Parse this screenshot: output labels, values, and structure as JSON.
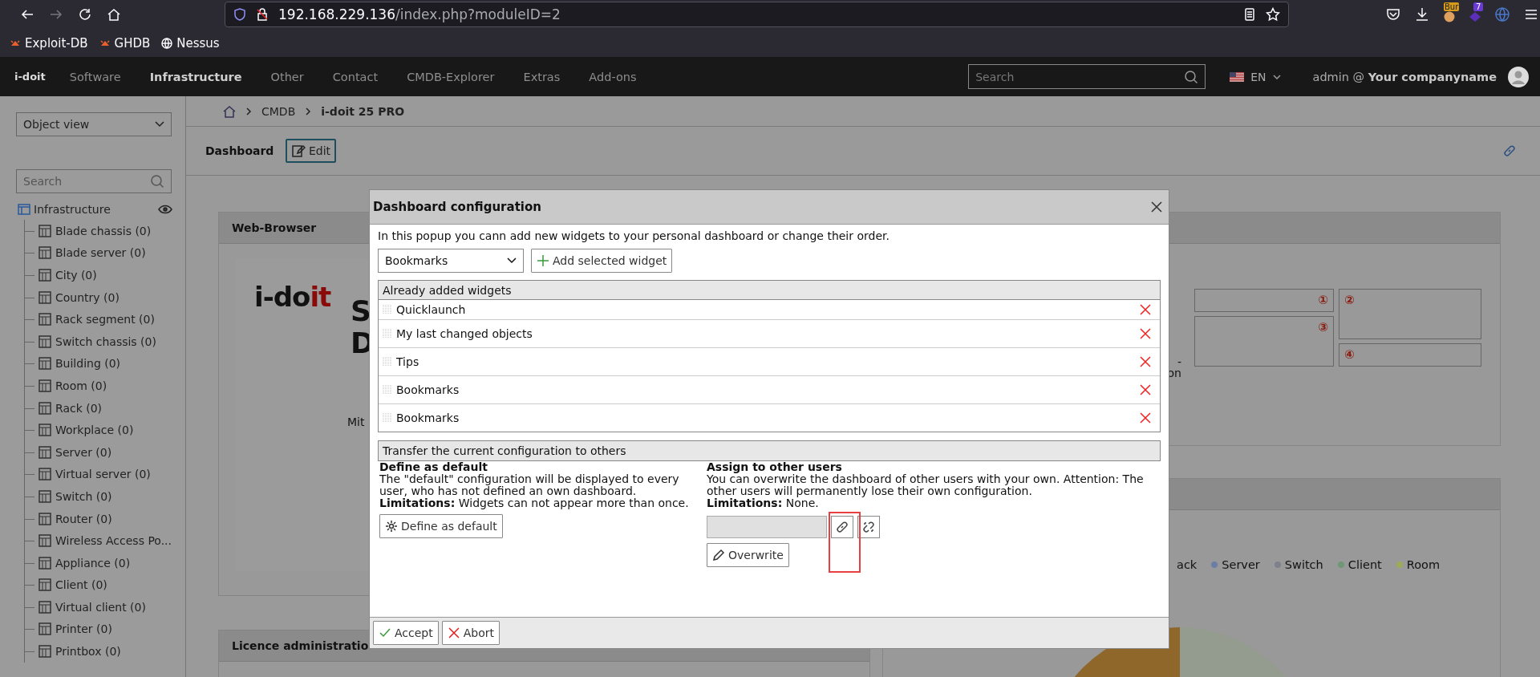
{
  "browser": {
    "url_host": "192.168.229.136",
    "url_path": "/index.php?moduleID=2",
    "forward_disabled": true,
    "extension_label": "Bur",
    "extension_badge": "7",
    "bookmarks": [
      {
        "label": "Exploit-DB",
        "kind": "bug"
      },
      {
        "label": "GHDB",
        "kind": "bug"
      },
      {
        "label": "Nessus",
        "kind": "globe"
      }
    ]
  },
  "navbar": {
    "logo": "i-doit",
    "items": [
      {
        "label": "Software",
        "selected": false
      },
      {
        "label": "Infrastructure",
        "selected": true
      },
      {
        "label": "Other",
        "selected": false
      },
      {
        "label": "Contact",
        "selected": false
      },
      {
        "label": "CMDB-Explorer",
        "selected": false
      },
      {
        "label": "Extras",
        "selected": false
      },
      {
        "label": "Add-ons",
        "selected": false
      }
    ],
    "search": {
      "placeholder": "Search"
    },
    "language": "EN",
    "user": "admin @ **Your companyname**"
  },
  "sidebar": {
    "view_select": "Object view",
    "search": {
      "placeholder": "Search"
    },
    "tree": {
      "label": "Infrastructure",
      "children": [
        {
          "label": "Blade chassis (0)"
        },
        {
          "label": "Blade server (0)"
        },
        {
          "label": "City (0)"
        },
        {
          "label": "Country (0)"
        },
        {
          "label": "Rack segment (0)"
        },
        {
          "label": "Switch chassis (0)"
        },
        {
          "label": "Building (0)"
        },
        {
          "label": "Room (0)"
        },
        {
          "label": "Rack (0)"
        },
        {
          "label": "Workplace (0)"
        },
        {
          "label": "Server (0)"
        },
        {
          "label": "Virtual server (0)"
        },
        {
          "label": "Switch (0)"
        },
        {
          "label": "Router (0)"
        },
        {
          "label": "Wireless Access Po..."
        },
        {
          "label": "Appliance (0)"
        },
        {
          "label": "Client (0)"
        },
        {
          "label": "Virtual client (0)"
        },
        {
          "label": "Printer (0)"
        },
        {
          "label": "Printbox (0)"
        }
      ]
    }
  },
  "breadcrumb": [
    "CMDB",
    "i-doit 25 PRO"
  ],
  "toolbar": {
    "title": "Dashboard",
    "edit_button": "Edit"
  },
  "web_browser_widget": {
    "title": "Web-Browser",
    "logo_dark": "i-do",
    "logo_red": "it",
    "fragments": [
      "S",
      "D"
    ],
    "caption": "Mit"
  },
  "licence_widget": {
    "title": "Licence administratio"
  },
  "layout_widget": {
    "fragments": [
      "-",
      "on"
    ],
    "boxes": [
      "①",
      "②",
      "③",
      "④"
    ]
  },
  "stats_widget": {
    "legend": [
      {
        "label": "ack"
      },
      {
        "label": "Server",
        "color": "#6c7da6"
      },
      {
        "label": "Switch",
        "color": "#7e808e"
      },
      {
        "label": "Client",
        "color": "#6f9776"
      },
      {
        "label": "Room",
        "color": "#9aac58"
      }
    ]
  },
  "dialog": {
    "title": "Dashboard configuration",
    "intro": "In this popup you cann add new widgets to your personal dashboard or change their order.",
    "widget_select": "Bookmarks",
    "add_button": "Add selected widget",
    "list_title": "Already added widgets",
    "widgets": [
      "Quicklaunch",
      "My last changed objects",
      "Tips",
      "Bookmarks",
      "Bookmarks"
    ],
    "transfer_title": "Transfer the current configuration to others",
    "default": {
      "heading": "Define as default",
      "text": "The \"default\" configuration will be displayed to every user, who has not defined an own dashboard.",
      "limitations": "**Limitations:** Widgets can not appear more than once.",
      "button": "Define as default"
    },
    "assign": {
      "heading": "Assign to other users",
      "text": "You can overwrite the dashboard of other users with your own. Attention: The other users will permanently lose their own configuration.",
      "limitations": "**Limitations:** None.",
      "button": "Overwrite"
    },
    "footer": [
      {
        "label": "Accept",
        "kind": "accept"
      },
      {
        "label": "Abort",
        "kind": "abort"
      }
    ]
  }
}
